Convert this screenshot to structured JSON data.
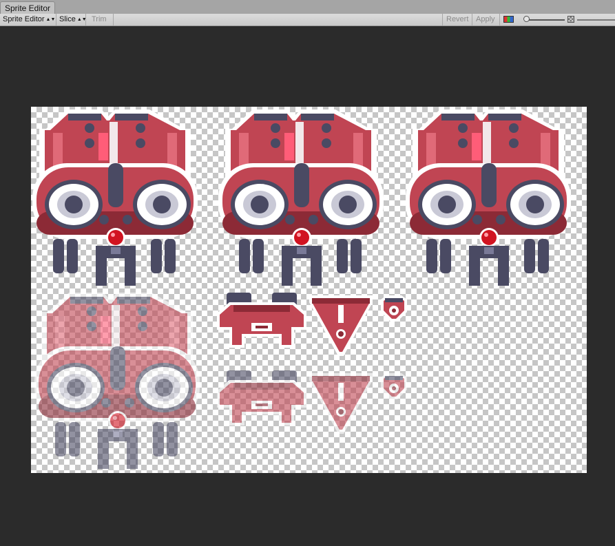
{
  "window": {
    "tab_title": "Sprite Editor"
  },
  "toolbar": {
    "mode_dropdown": "Sprite Editor",
    "slice_dropdown": "Slice",
    "trim_label": "Trim",
    "revert_label": "Revert",
    "apply_label": "Apply"
  },
  "icons": {
    "channel_toggle": "rgb-channel-icon",
    "zoom_slider": "zoom-slider",
    "mip_slider": "mip-level-icon"
  },
  "colors": {
    "ship_body": "#c04553",
    "ship_body_dark": "#8c2a36",
    "ship_steel": "#4a4a63",
    "ship_core": "#d11321",
    "canvas_bg": "#2b2b2b"
  },
  "sprite_sheet": {
    "sprites": [
      {
        "kind": "mothership",
        "variant": "normal"
      },
      {
        "kind": "mothership",
        "variant": "normal"
      },
      {
        "kind": "mothership",
        "variant": "normal"
      },
      {
        "kind": "mothership",
        "variant": "faded"
      },
      {
        "kind": "turret",
        "variant": "normal"
      },
      {
        "kind": "turret",
        "variant": "faded"
      },
      {
        "kind": "fighter",
        "variant": "normal"
      },
      {
        "kind": "fighter",
        "variant": "faded"
      },
      {
        "kind": "drone",
        "variant": "normal"
      },
      {
        "kind": "drone",
        "variant": "faded"
      }
    ]
  }
}
